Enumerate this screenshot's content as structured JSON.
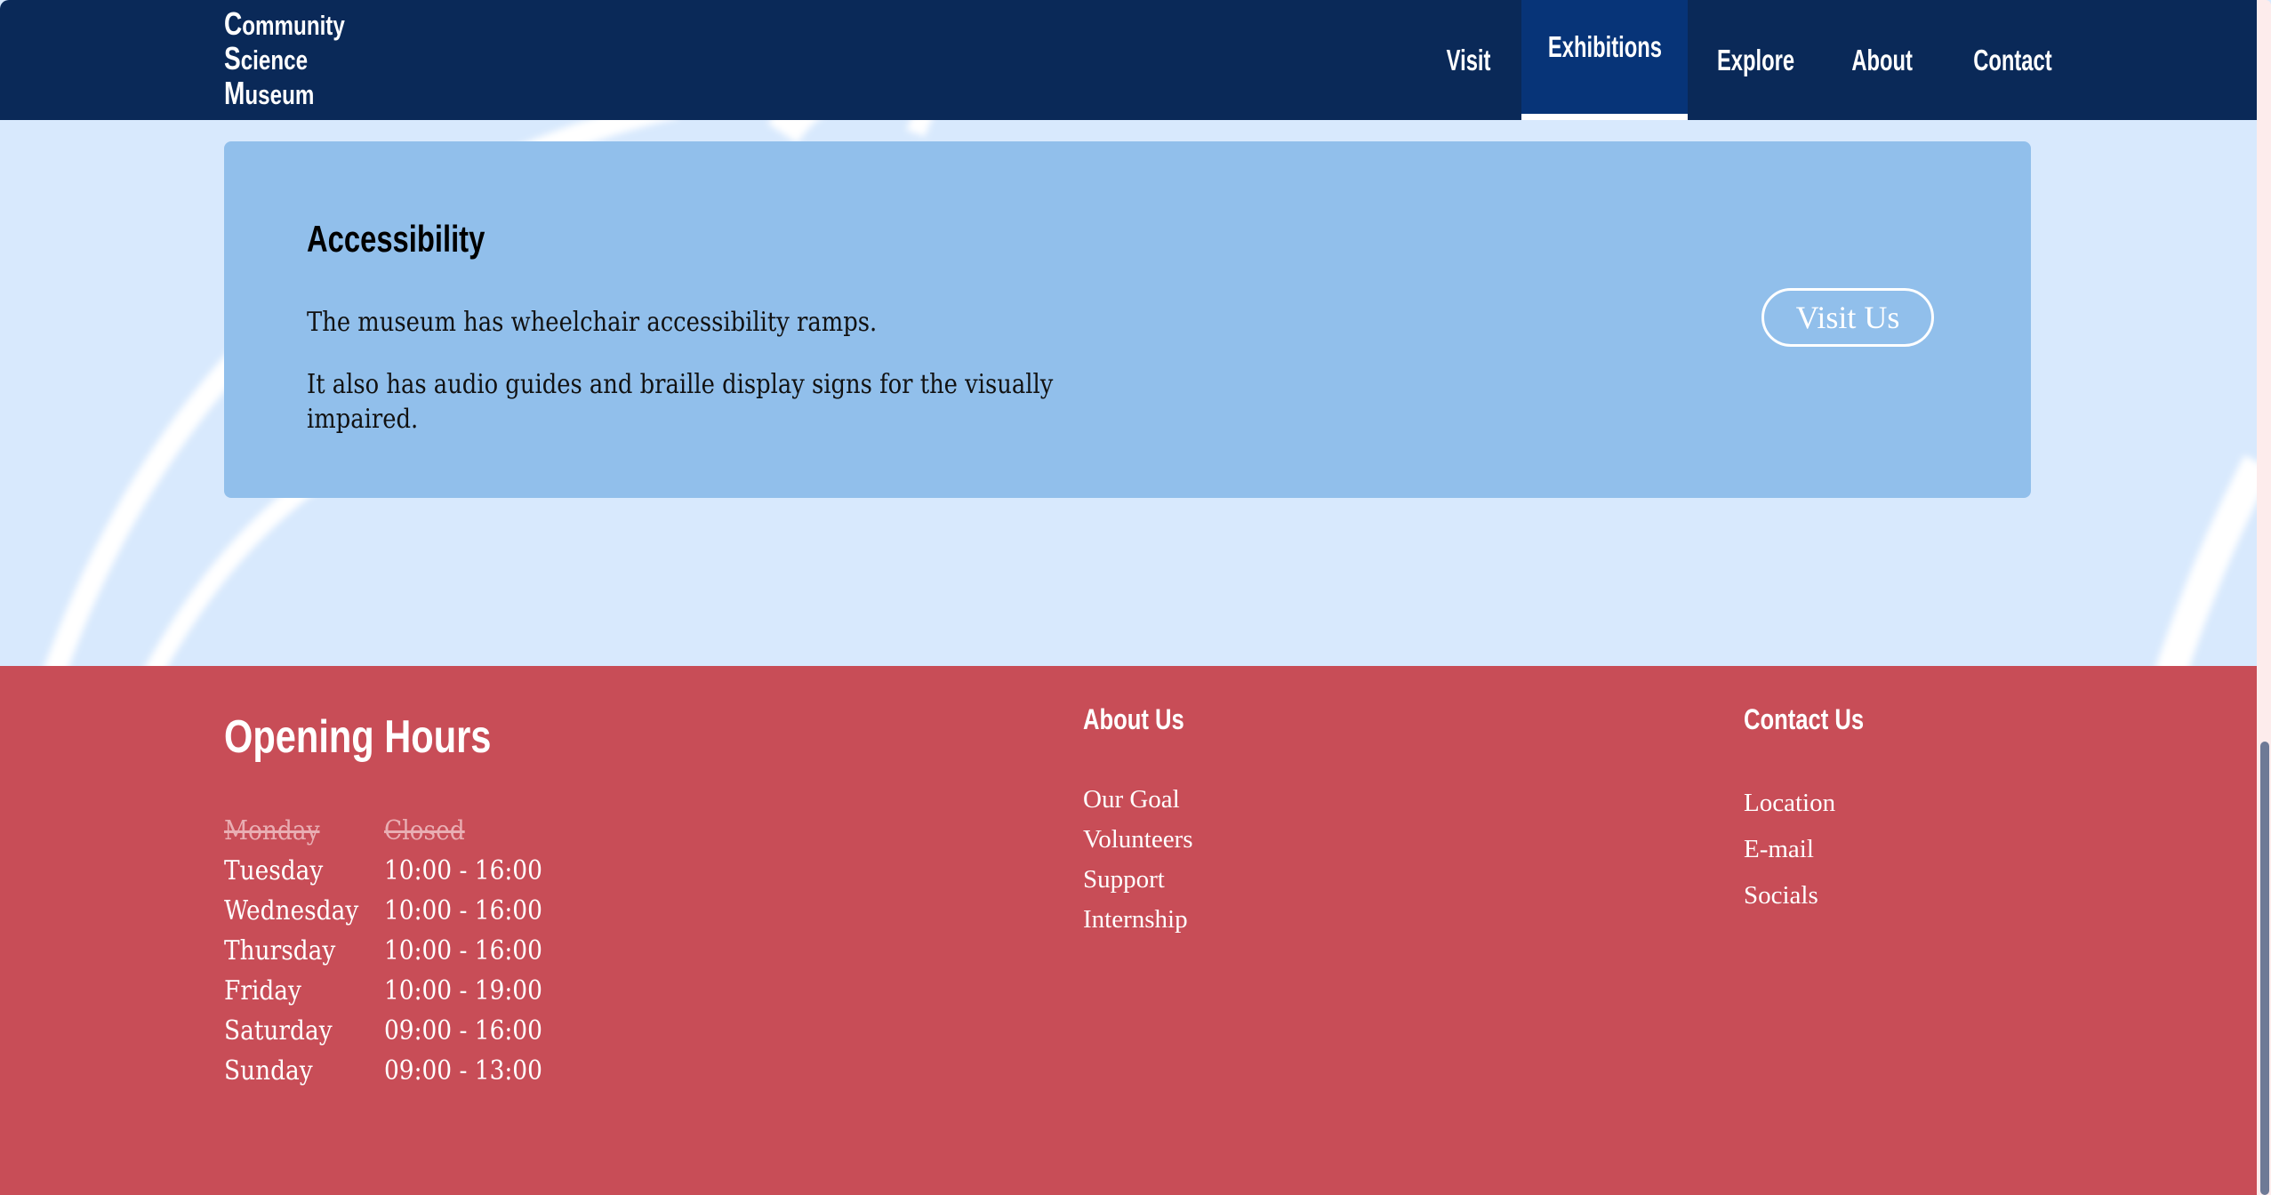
{
  "nav": {
    "logo_lines": [
      {
        "cap": "C",
        "rest": "ommunity"
      },
      {
        "cap": "S",
        "rest": "cience"
      },
      {
        "cap": "M",
        "rest": "useum"
      }
    ],
    "items": [
      {
        "label": "Visit",
        "active": false
      },
      {
        "label": "Exhibitions",
        "active": true
      },
      {
        "label": "Explore",
        "active": false
      },
      {
        "label": "About",
        "active": false
      },
      {
        "label": "Contact",
        "active": false
      }
    ]
  },
  "card": {
    "title": "Accessibility",
    "paragraphs": [
      "The museum has wheelchair accessibility ramps.",
      "It also has audio guides and braille display signs for the visually impaired."
    ],
    "button_label": "Visit Us"
  },
  "footer": {
    "hours_title": "Opening Hours",
    "hours": [
      {
        "day": "Monday",
        "time": "Closed",
        "closed": true
      },
      {
        "day": "Tuesday",
        "time": "10:00 - 16:00",
        "closed": false
      },
      {
        "day": "Wednesday",
        "time": "10:00 - 16:00",
        "closed": false
      },
      {
        "day": "Thursday",
        "time": "10:00 - 16:00",
        "closed": false
      },
      {
        "day": "Friday",
        "time": "10:00 - 19:00",
        "closed": false
      },
      {
        "day": "Saturday",
        "time": "09:00 - 16:00",
        "closed": false
      },
      {
        "day": "Sunday",
        "time": "09:00 - 13:00",
        "closed": false
      }
    ],
    "about": {
      "title": "About Us",
      "links": [
        "Our Goal",
        "Volunteers",
        "Support",
        "Internship"
      ]
    },
    "contact": {
      "title": "Contact Us",
      "links": [
        "Location",
        "E-mail",
        "Socials"
      ]
    }
  },
  "colors": {
    "nav_bg": "#0a2958",
    "nav_active_bg": "#073478",
    "page_bg": "#d8e9fd",
    "card_bg": "#91bfeb",
    "footer_bg": "#c84d57",
    "closed_text": "#e9aeb3"
  }
}
